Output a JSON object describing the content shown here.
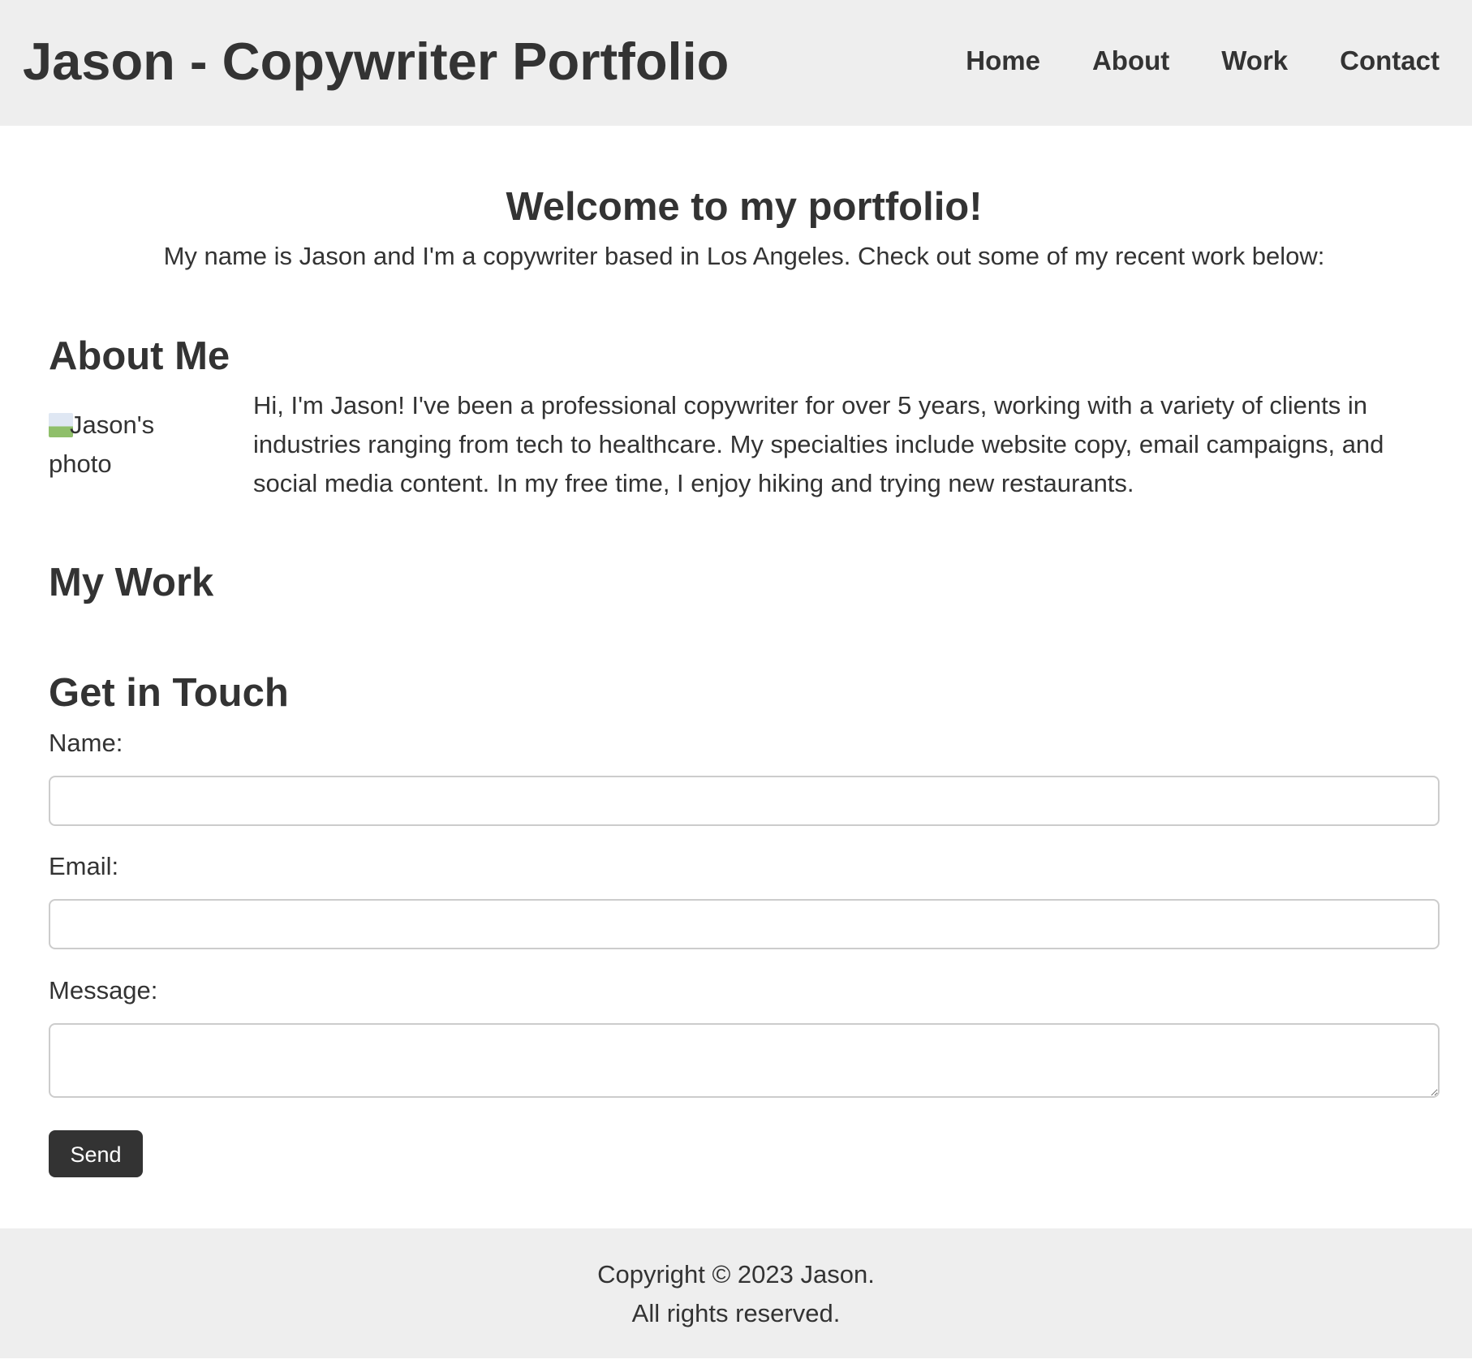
{
  "header": {
    "title": "Jason - Copywriter Portfolio",
    "nav": [
      {
        "label": "Home"
      },
      {
        "label": "About"
      },
      {
        "label": "Work"
      },
      {
        "label": "Contact"
      }
    ]
  },
  "intro": {
    "heading": "Welcome to my portfolio!",
    "text": "My name is Jason and I'm a copywriter based in Los Angeles. Check out some of my recent work below:"
  },
  "about": {
    "heading": "About Me",
    "photo_alt": "Jason's photo",
    "text": "Hi, I'm Jason! I've been a professional copywriter for over 5 years, working with a variety of clients in industries ranging from tech to healthcare. My specialties include website copy, email campaigns, and social media content. In my free time, I enjoy hiking and trying new restaurants."
  },
  "work": {
    "heading": "My Work"
  },
  "contact": {
    "heading": "Get in Touch",
    "name_label": "Name:",
    "name_value": "",
    "email_label": "Email:",
    "email_value": "",
    "message_label": "Message:",
    "message_value": "",
    "send_label": "Send"
  },
  "footer": {
    "line1": "Copyright © 2023 Jason.",
    "line2": "All rights reserved."
  },
  "colors": {
    "header_bg": "#eeeeee",
    "text": "#333333",
    "button_bg": "#333333",
    "button_text": "#ffffff",
    "input_border": "#cccccc"
  },
  "icons": {
    "photo": "broken-image-icon"
  }
}
